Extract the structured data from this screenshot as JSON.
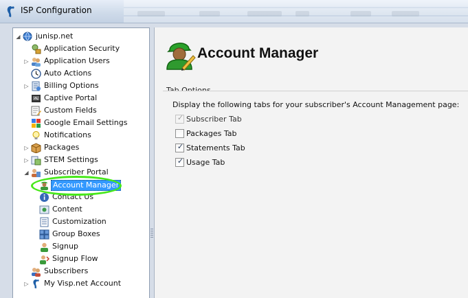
{
  "window": {
    "title": "ISP Configuration"
  },
  "tree": {
    "root": {
      "label": "junisp.net",
      "icon": "globe-icon"
    },
    "items": [
      {
        "label": "Application Security",
        "icon": "key-lock-icon"
      },
      {
        "label": "Application Users",
        "icon": "users-icon"
      },
      {
        "label": "Auto Actions",
        "icon": "clock-icon"
      },
      {
        "label": "Billing Options",
        "icon": "billing-icon"
      },
      {
        "label": "Captive Portal",
        "icon": "portal-icon"
      },
      {
        "label": "Custom Fields",
        "icon": "form-edit-icon"
      },
      {
        "label": "Google Email Settings",
        "icon": "google-icon"
      },
      {
        "label": "Notifications",
        "icon": "bulb-icon"
      },
      {
        "label": "Packages",
        "icon": "package-icon"
      },
      {
        "label": "STEM Settings",
        "icon": "stem-icon"
      },
      {
        "label": "Subscriber Portal",
        "icon": "portal-users-icon"
      },
      {
        "label": "Account Manager",
        "icon": "account-manager-icon"
      },
      {
        "label": "Contact Us",
        "icon": "info-icon"
      },
      {
        "label": "Content",
        "icon": "content-icon"
      },
      {
        "label": "Customization",
        "icon": "customization-icon"
      },
      {
        "label": "Group Boxes",
        "icon": "group-boxes-icon"
      },
      {
        "label": "Signup",
        "icon": "signup-icon"
      },
      {
        "label": "Signup Flow",
        "icon": "signup-flow-icon"
      },
      {
        "label": "Subscribers",
        "icon": "subscribers-icon"
      },
      {
        "label": "My Visp.net Account",
        "icon": "visp-icon"
      }
    ],
    "selected": "Account Manager"
  },
  "content": {
    "title": "Account Manager",
    "group_label": "Tab Options",
    "description": "Display the following tabs for your subscriber's Account Management page:",
    "options": [
      {
        "label": "Subscriber Tab",
        "checked": true,
        "disabled": true
      },
      {
        "label": "Packages Tab",
        "checked": false,
        "disabled": false
      },
      {
        "label": "Statements Tab",
        "checked": true,
        "disabled": false
      },
      {
        "label": "Usage Tab",
        "checked": true,
        "disabled": false
      }
    ]
  },
  "colors": {
    "selection": "#3399ff",
    "highlight_ring": "#47e81a",
    "panel_bg": "#f3f3f3"
  }
}
